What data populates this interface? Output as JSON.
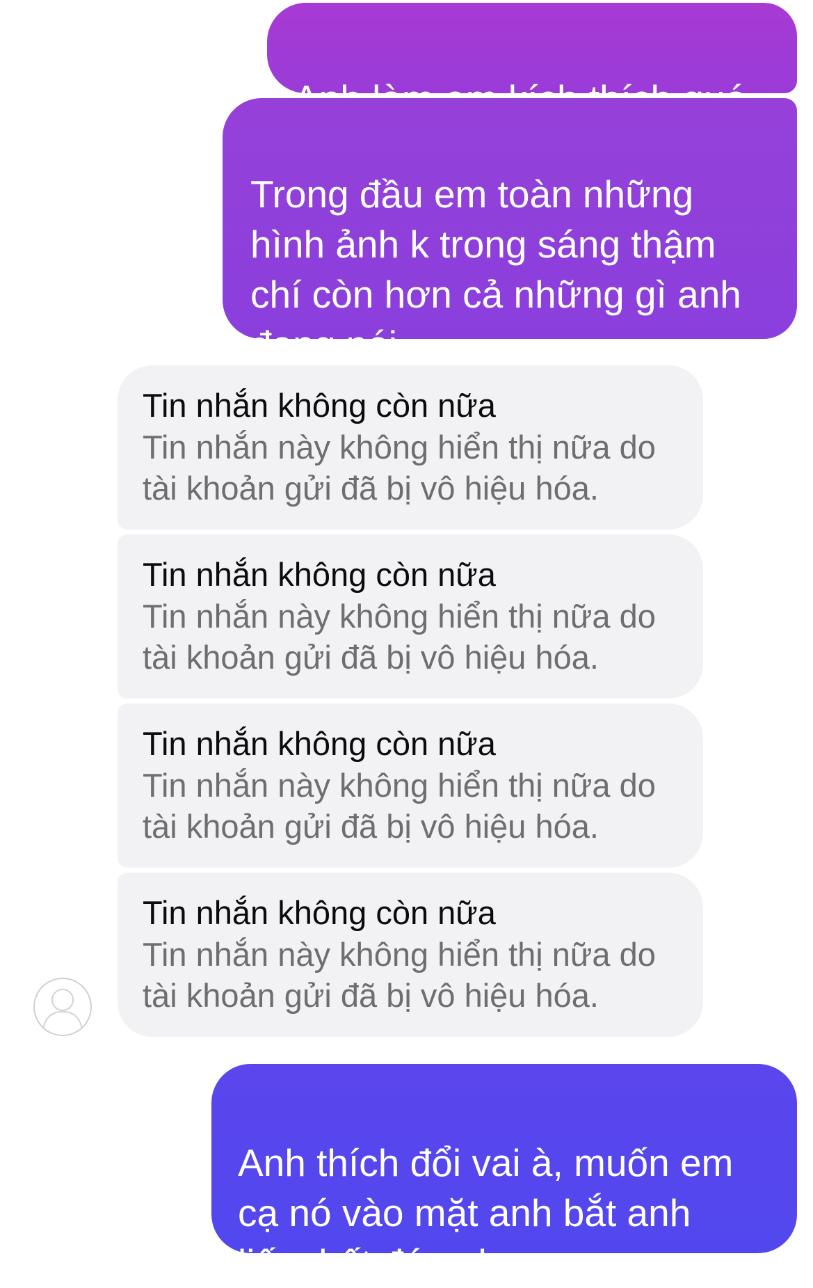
{
  "conversation": {
    "outgoing": [
      {
        "text": "Anh làm em kích thích quá"
      },
      {
        "text": "Trong đầu em toàn những\nhình ảnh k trong sáng thậm\nchí còn hơn cả những gì anh\nđang nói"
      },
      {
        "text": "Anh thích đổi vai à, muốn em\ncạ nó vào mặt anh bắt anh\nliếm hết đúng k"
      }
    ],
    "removed_messages": [
      {
        "title": "Tin nhắn không còn nữa",
        "body": "Tin nhắn này không hiển thị nữa do\ntài khoản gửi đã bị vô hiệu hóa."
      },
      {
        "title": "Tin nhắn không còn nữa",
        "body": "Tin nhắn này không hiển thị nữa do\ntài khoản gửi đã bị vô hiệu hóa."
      },
      {
        "title": "Tin nhắn không còn nữa",
        "body": "Tin nhắn này không hiển thị nữa do\ntài khoản gửi đã bị vô hiệu hóa."
      },
      {
        "title": "Tin nhắn không còn nữa",
        "body": "Tin nhắn này không hiển thị nữa do\ntài khoản gửi đã bị vô hiệu hóa."
      }
    ],
    "avatar": {
      "icon": "default-user-icon"
    }
  },
  "colors": {
    "outgoing_top": "#a73ad3",
    "outgoing_bottom": "#5247ee",
    "removed_bg": "#f2f2f4",
    "removed_title": "#0b0b0d",
    "removed_body": "#6d6d72"
  }
}
